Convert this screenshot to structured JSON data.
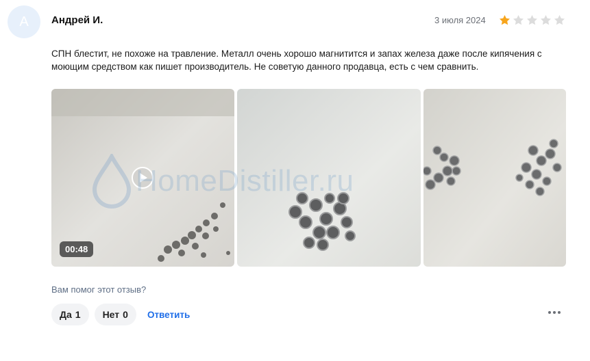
{
  "review": {
    "avatar_letter": "А",
    "author": "Андрей И.",
    "date": "3 июля 2024",
    "rating": 1,
    "rating_max": 5,
    "text": "СПН блестит, не похоже на травление. Металл очень хорошо магнитится и запах железа даже после кипячения с моющим средством как пишет производитель. Не советую данного продавца, есть с чем сравнить.",
    "media": [
      {
        "type": "video",
        "duration": "00:48"
      },
      {
        "type": "photo"
      },
      {
        "type": "photo"
      }
    ],
    "watermark": "HomeDistiller.ru"
  },
  "feedback": {
    "question": "Вам помог этот отзыв?",
    "yes_label": "Да",
    "yes_count": "1",
    "no_label": "Нет",
    "no_count": "0",
    "reply_label": "Ответить"
  },
  "colors": {
    "star_filled": "#f7a51c",
    "star_empty": "#dcdcdc",
    "link": "#1f6ee8",
    "avatar_bg": "#e7f0fb"
  }
}
